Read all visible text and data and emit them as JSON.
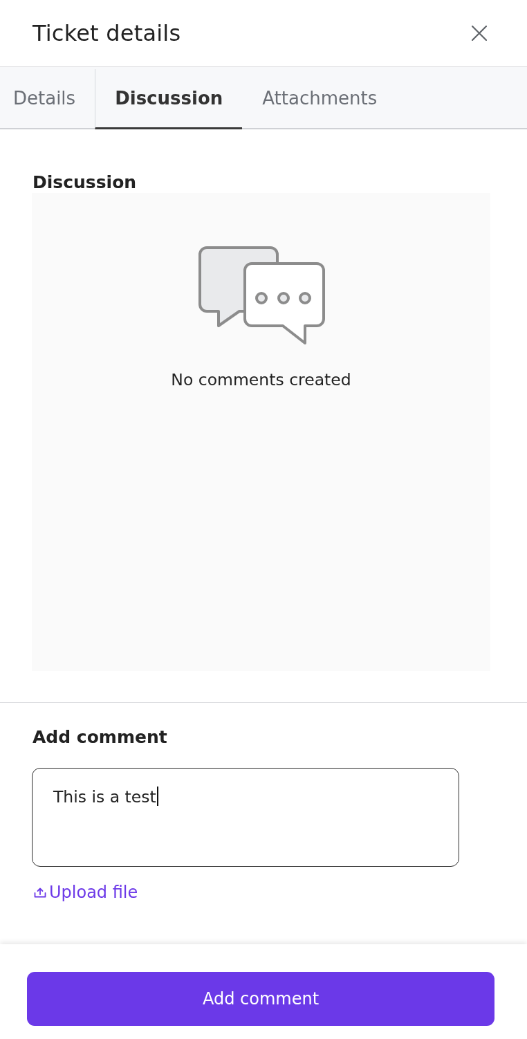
{
  "panel": {
    "title": "Ticket details"
  },
  "tabs": [
    {
      "label": "Details",
      "selected": false
    },
    {
      "label": "Discussion",
      "selected": true
    },
    {
      "label": "Attachments",
      "selected": false
    }
  ],
  "discussion": {
    "heading": "Discussion",
    "empty_message": "No comments created"
  },
  "add_comment": {
    "heading": "Add comment",
    "field": {
      "value": "This is a test",
      "focused": true
    },
    "upload_link": "Upload file"
  },
  "footer": {
    "submit_button": "Add comment"
  }
}
